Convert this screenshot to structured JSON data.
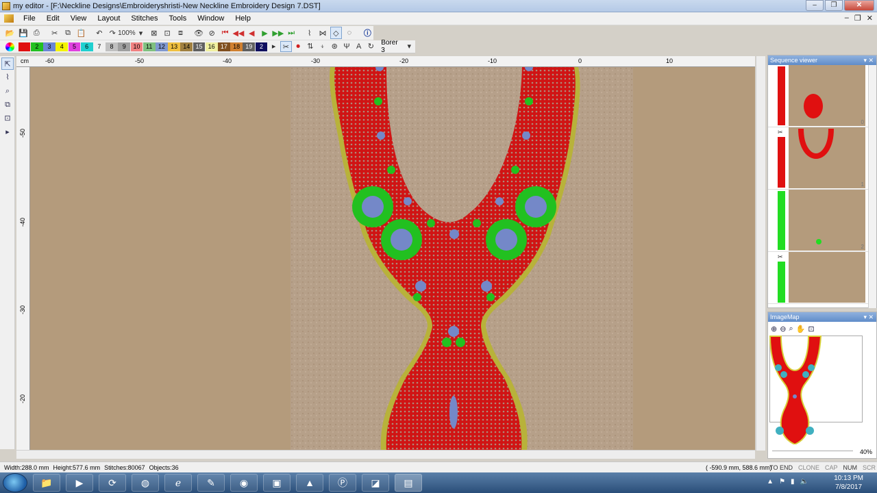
{
  "window": {
    "title": "my editor - [F:\\Neckline Designs\\Embroideryshristi-New Neckline Embroidery Design 7.DST]"
  },
  "menu": [
    "File",
    "Edit",
    "View",
    "Layout",
    "Stitches",
    "Tools",
    "Window",
    "Help"
  ],
  "toolbar": {
    "zoom": "100%"
  },
  "colors": {
    "swatches": [
      {
        "label": "",
        "color": "#e01010"
      },
      {
        "label": "2",
        "color": "#22c020"
      },
      {
        "label": "3",
        "color": "#6b86d6"
      },
      {
        "label": "4",
        "color": "#f3f300"
      },
      {
        "label": "5",
        "color": "#e040e0"
      },
      {
        "label": "6",
        "color": "#20d0d0"
      },
      {
        "label": "7",
        "color": "#f0f0f0"
      },
      {
        "label": "8",
        "color": "#c0c0c0"
      },
      {
        "label": "9",
        "color": "#a0a0a0"
      },
      {
        "label": "10",
        "color": "#f08080"
      },
      {
        "label": "11",
        "color": "#80c080"
      },
      {
        "label": "12",
        "color": "#8098d0"
      },
      {
        "label": "13",
        "color": "#f0c040"
      },
      {
        "label": "14",
        "color": "#a08040"
      },
      {
        "label": "15",
        "color": "#606060"
      },
      {
        "label": "16",
        "color": "#f0f0a0"
      },
      {
        "label": "17",
        "color": "#805020"
      },
      {
        "label": "18",
        "color": "#d08030"
      },
      {
        "label": "19",
        "color": "#606060"
      },
      {
        "label": "2",
        "color": "#101060"
      }
    ],
    "thread": "Borer 3"
  },
  "ruler": {
    "unit": "cm",
    "top_labels": [
      "-60",
      "-50",
      "-40",
      "-30",
      "-20",
      "-10",
      "0",
      "10"
    ],
    "left_labels": [
      "-50",
      "-40",
      "-30",
      "-20"
    ]
  },
  "sequence_viewer": {
    "title": "Sequence viewer",
    "items": [
      {
        "index": "0",
        "color": "#e01010",
        "scissors": false
      },
      {
        "index": "1",
        "color": "#e01010",
        "scissors": true
      },
      {
        "index": "2",
        "color": "#22dd22",
        "scissors": false
      },
      {
        "index": "3",
        "color": "#22dd22",
        "scissors": true
      }
    ]
  },
  "imagemap": {
    "title": "ImageMap",
    "zoom": "40%"
  },
  "status": {
    "width": "Width:288.0 mm",
    "height": "Height:577.6 mm",
    "stitches": "Stitches:80067",
    "objects": "Objects:36",
    "coords": "( -590.9 mm,   588.6 mm)",
    "keys": [
      "TO END",
      "CLONE",
      "CAP",
      "NUM",
      "SCR"
    ]
  },
  "taskbar": {
    "time": "10:13 PM",
    "date": "7/8/2017"
  },
  "icons": [
    "new-file-icon",
    "open-icon",
    "save-icon",
    "print-icon",
    "cut-icon",
    "copy-icon",
    "paste-icon",
    "undo-icon",
    "redo-icon",
    "info-icon",
    "scissors-icon",
    "zoom-in-icon",
    "zoom-out-icon",
    "hand-icon",
    "fit-icon"
  ]
}
